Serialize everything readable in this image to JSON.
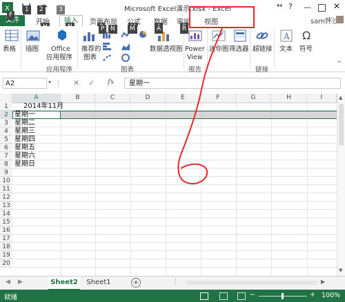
{
  "title_bar": {
    "title": "Microsoft Excel演示.xlsx - Excel",
    "help_glyph": "?",
    "user": "sam怀沙",
    "keytips": [
      "1",
      "2",
      "3"
    ]
  },
  "tabs": [
    {
      "label": "文件",
      "keytip": "F"
    },
    {
      "label": "开始",
      "keytip": "H"
    },
    {
      "label": "插入",
      "keytip": "N"
    },
    {
      "label": "页面布局",
      "keytip": "P"
    },
    {
      "label": "公式",
      "keytip": "M"
    },
    {
      "label": "数据",
      "keytip": "A"
    },
    {
      "label": "审阅",
      "keytip": "R"
    },
    {
      "label": "视图",
      "keytip": ""
    }
  ],
  "ribbon": {
    "table": "表格",
    "illustrations": "插图",
    "office_apps_line1": "Office",
    "office_apps_line2": "应用程序",
    "recommended_line1": "推荐的",
    "recommended_line2": "图表",
    "pivotchart": "数据透视图",
    "power_line1": "Power",
    "power_line2": "View",
    "sparkline": "迷你图",
    "slicer": "筛选器",
    "hyperlink": "超链接",
    "text": "文本",
    "symbol": "符号",
    "group_apps": "应用程序",
    "group_charts": "图表",
    "group_reports": "报告",
    "group_links": "链接"
  },
  "formula_bar": {
    "name_box": "A2",
    "fx": "fx",
    "content": "星期一"
  },
  "columns": [
    "A",
    "B",
    "C",
    "D",
    "E",
    "F",
    "G",
    "H",
    "I"
  ],
  "rows": [
    "1",
    "2",
    "3",
    "4",
    "5",
    "6",
    "7",
    "8",
    "9",
    "10",
    "11",
    "12",
    "13",
    "14",
    "15",
    "16",
    "17",
    "18",
    "19",
    "20"
  ],
  "cells": {
    "A1": "2014年11月",
    "A2": "星期一",
    "A3": "星期二",
    "A4": "星期三",
    "A5": "星期四",
    "A6": "星期五",
    "A7": "星期六",
    "A8": "星期日"
  },
  "sheets": [
    "Sheet2",
    "Sheet1"
  ],
  "status": {
    "ready": "就绪",
    "zoom": "100%"
  },
  "colors": {
    "excel_green": "#217346",
    "annotation_red": "#e8262b"
  }
}
